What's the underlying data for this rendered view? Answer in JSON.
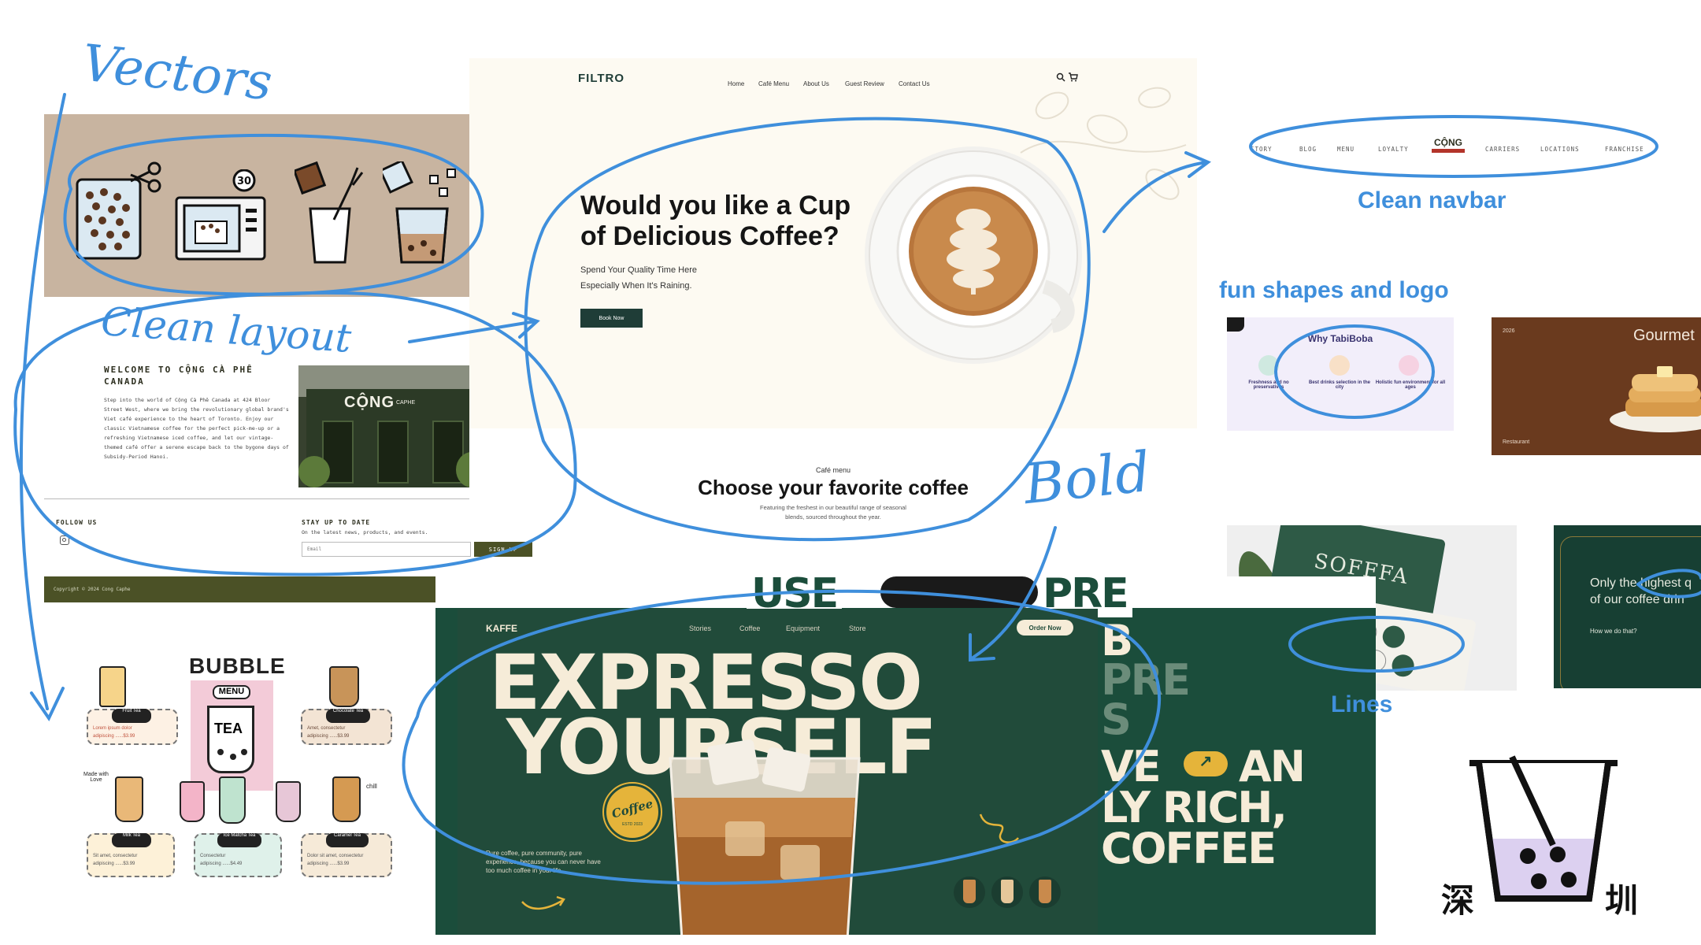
{
  "annotations": {
    "vectors": "Vectors",
    "clean_layout": "Clean layout",
    "clean_navbar": "Clean navbar",
    "fun_shapes": "fun shapes and logo",
    "bold": "Bold",
    "lines": "Lines"
  },
  "colors": {
    "annotation_blue": "#3f8fdc",
    "filtro_green": "#1f3d37",
    "cong_olive": "#4b5126",
    "kaffe_green": "#214b3a",
    "vectors_tan": "#c8b4a0",
    "cong_red": "#b3342a"
  },
  "vectors_card": {
    "timer": "30"
  },
  "cong": {
    "welcome": "WELCOME TO CỘNG CÀ PHÊ CANADA",
    "body": "Step into the world of Cộng Cà Phê Canada at 424 Bloor Street West, where we bring the revolutionary global brand's Viet café experience to the heart of Toronto. Enjoy our classic Vietnamese coffee for the perfect pick-me-up or a refreshing Vietnamese iced coffee, and let our vintage-themed café offer a serene escape back to the bygone days of Subsidy-Period Hanoi.",
    "shop_sign": "CỘNG",
    "shop_sign_small": "CAPHE",
    "follow_us": "FOLLOW US",
    "stay_title": "STAY UP TO DATE",
    "stay_sub": "On the latest news, products, and events.",
    "email_placeholder": "Email",
    "signup": "SIGN UP",
    "copyright": "Copyright © 2024 Cong Caphe"
  },
  "filtro": {
    "logo": "FILTRO",
    "nav": [
      "Home",
      "Café Menu",
      "About Us",
      "Guest Review",
      "Contact Us"
    ],
    "hero_title": "Would you like a Cup of Delicious Coffee?",
    "hero_sub_1": "Spend Your Quality Time Here",
    "hero_sub_2": "Especially When It's Raining.",
    "cta": "Book Now",
    "menu_eyebrow": "Café menu",
    "menu_title": "Choose your favorite coffee",
    "menu_sub_1": "Featuring the freshest in our beautiful range of seasonal",
    "menu_sub_2": "blends, sourced throughout the year."
  },
  "cong_navbar": {
    "items": [
      "STORY",
      "BLOG",
      "MENU",
      "LOYALTY",
      "CARRIERS",
      "LOCATIONS",
      "FRANCHISE"
    ],
    "logo": "CỘNG"
  },
  "tabiboba": {
    "title": "Why TabiBoba",
    "features": [
      {
        "title": "Freshness and no preservatives",
        "icon": "leaf-icon"
      },
      {
        "title": "Best drinks selection in the city",
        "icon": "cup-icon"
      },
      {
        "title": "Holistic fun environment for all ages",
        "icon": "star-icon"
      }
    ]
  },
  "gourmet": {
    "title": "Gourmet",
    "year": "2026",
    "footer": "Restaurant"
  },
  "sofffa": {
    "brand": "SOFFFA"
  },
  "highest": {
    "line1": "Only the highest q",
    "line2": "of our coffee drin",
    "link": "How we do that?"
  },
  "bubble_menu": {
    "title": "BUBBLE",
    "menu_label": "MENU",
    "cup_label": "TEA",
    "items": [
      {
        "name": "Fruit Tea",
        "desc": "Lorem ipsum dolor",
        "price": "adipiscing ......$3.99"
      },
      {
        "name": "Chocolate Tea",
        "desc": "Amet, consectetur",
        "price": "adipiscing ......$3.99"
      },
      {
        "name": "Milk Tea",
        "desc": "Sit amet, consectetur",
        "price": "adipiscing ......$3.99"
      },
      {
        "name": "Ice Matcha Tea",
        "desc": "Consectetur",
        "price": "adipiscing ......$4.49"
      },
      {
        "name": "Caramel Tea",
        "desc": "Dolor sit amet, consectetur",
        "price": "adipiscing ......$3.99"
      }
    ],
    "made_with_love": "Made with Love",
    "chill": "chill"
  },
  "kaffe": {
    "logo": "KAFFE",
    "nav": [
      "Stories",
      "Coffee",
      "Equipment",
      "Store"
    ],
    "order_btn": "Order Now",
    "headline_1": "EXPRESSO",
    "headline_2": "YOURSELF",
    "badge": "Coffee",
    "badge_ring": "ESTD 2023",
    "tagline": "Pure coffee, pure community, pure experience, because you can never have too much coffee in your life",
    "back_row_1": "USE",
    "back_row_1b": "PRE",
    "back_row_2": "B",
    "back_row_3": "PRE",
    "back_row_4": "S",
    "back_row_5": "VE",
    "back_row_5b": "AN",
    "back_row_6": "LY RICH,",
    "back_row_7": "COFFEE"
  },
  "shenzhen": {
    "left": "深",
    "right": "圳"
  }
}
